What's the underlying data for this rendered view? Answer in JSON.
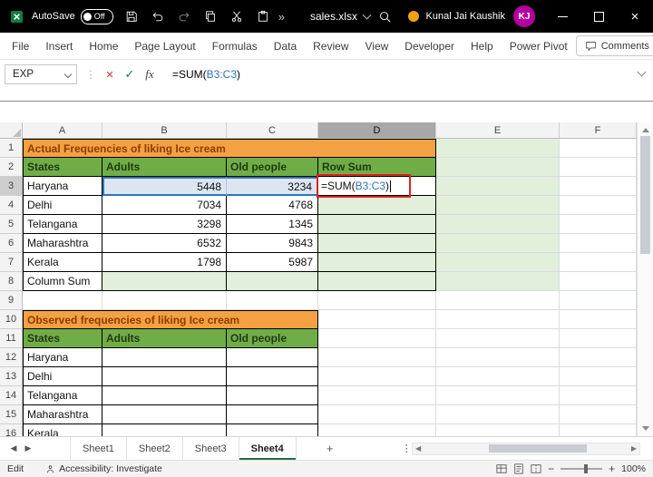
{
  "titlebar": {
    "autosave_label": "AutoSave",
    "autosave_state": "Off",
    "filename": "sales.xlsx",
    "user_name": "Kunal Jai Kaushik",
    "user_initials": "KJ"
  },
  "menubar": {
    "items": [
      "File",
      "Insert",
      "Home",
      "Page Layout",
      "Formulas",
      "Data",
      "Review",
      "View",
      "Developer",
      "Help",
      "Power Pivot"
    ],
    "comments_label": "Comments"
  },
  "formula_bar": {
    "name_box_value": "EXP",
    "cancel_glyph": "×",
    "enter_glyph": "✓",
    "fx_label": "fx",
    "formula": {
      "prefix": "=SUM(",
      "reference": "B3:C3",
      "suffix": ")"
    }
  },
  "grid": {
    "column_headers": [
      "A",
      "B",
      "C",
      "D",
      "E",
      "F"
    ],
    "active_column": "D",
    "active_row": 3,
    "row_count": 16,
    "cells": {
      "A1": {
        "t": "Actual Frequencies of liking Ice cream",
        "span": 4,
        "s": "title"
      },
      "E1": {
        "s": "fill"
      },
      "A2": {
        "t": "States",
        "s": "th"
      },
      "B2": {
        "t": "Adults",
        "s": "th"
      },
      "C2": {
        "t": "Old people",
        "s": "th"
      },
      "D2": {
        "t": "Row Sum",
        "s": "th"
      },
      "E2": {
        "s": "fill"
      },
      "A3": {
        "t": "Haryana",
        "s": "tc"
      },
      "B3": {
        "t": "5448",
        "s": "num refL"
      },
      "C3": {
        "t": "3234",
        "s": "num refR"
      },
      "D3": {
        "s": "edit"
      },
      "E3": {
        "s": "fill"
      },
      "A4": {
        "t": "Delhi",
        "s": "tc"
      },
      "B4": {
        "t": "7034",
        "s": "num"
      },
      "C4": {
        "t": "4768",
        "s": "num"
      },
      "D4": {
        "s": "tg"
      },
      "E4": {
        "s": "fill"
      },
      "A5": {
        "t": "Telangana",
        "s": "tc"
      },
      "B5": {
        "t": "3298",
        "s": "num"
      },
      "C5": {
        "t": "1345",
        "s": "num"
      },
      "D5": {
        "s": "tg"
      },
      "E5": {
        "s": "fill"
      },
      "A6": {
        "t": "Maharashtra",
        "s": "tc"
      },
      "B6": {
        "t": "6532",
        "s": "num"
      },
      "C6": {
        "t": "9843",
        "s": "num"
      },
      "D6": {
        "s": "tg"
      },
      "E6": {
        "s": "fill"
      },
      "A7": {
        "t": "Kerala",
        "s": "tc"
      },
      "B7": {
        "t": "1798",
        "s": "num"
      },
      "C7": {
        "t": "5987",
        "s": "num"
      },
      "D7": {
        "s": "tg"
      },
      "E7": {
        "s": "fill"
      },
      "A8": {
        "t": "Column Sum",
        "s": "tc"
      },
      "B8": {
        "s": "tg"
      },
      "C8": {
        "s": "tg"
      },
      "D8": {
        "s": "tg"
      },
      "E8": {
        "s": "fill"
      },
      "A10": {
        "t": "Observed frequencies of liking Ice cream",
        "span": 3,
        "s": "title"
      },
      "A11": {
        "t": "States",
        "s": "th"
      },
      "B11": {
        "t": "Adults",
        "s": "th"
      },
      "C11": {
        "t": "Old people",
        "s": "th"
      },
      "A12": {
        "t": "Haryana",
        "s": "tc"
      },
      "B12": {
        "s": "tc"
      },
      "C12": {
        "s": "tc"
      },
      "A13": {
        "t": "Delhi",
        "s": "tc"
      },
      "B13": {
        "s": "tc"
      },
      "C13": {
        "s": "tc"
      },
      "A14": {
        "t": "Telangana",
        "s": "tc"
      },
      "B14": {
        "s": "tc"
      },
      "C14": {
        "s": "tc"
      },
      "A15": {
        "t": "Maharashtra",
        "s": "tc"
      },
      "B15": {
        "s": "tc"
      },
      "C15": {
        "s": "tc"
      },
      "A16": {
        "t": "Kerala",
        "s": "tc"
      },
      "B16": {
        "s": "tc"
      },
      "C16": {
        "s": "tc"
      }
    }
  },
  "sheet_tabs": {
    "nav_left": "◀",
    "nav_right": "▶",
    "tabs": [
      {
        "label": "Sheet1"
      },
      {
        "label": "Sheet2"
      },
      {
        "label": "Sheet3"
      },
      {
        "label": "Sheet4",
        "active": true
      }
    ],
    "add_label": "+",
    "menu_glyph": "⋮"
  },
  "status_bar": {
    "mode": "Edit",
    "accessibility": "Accessibility: Investigate",
    "zoom_level": "100%"
  },
  "colors": {
    "orange": "#F3A143",
    "green_header": "#70AD47",
    "light_green": "#E2EFDA",
    "excel_green": "#1E7145",
    "ref_blue": "#2E75B6",
    "ref_fill": "#DCE6F1",
    "annotation_red": "#E02020",
    "avatar": "#B4009E",
    "badge_orange": "#F0A30A"
  }
}
